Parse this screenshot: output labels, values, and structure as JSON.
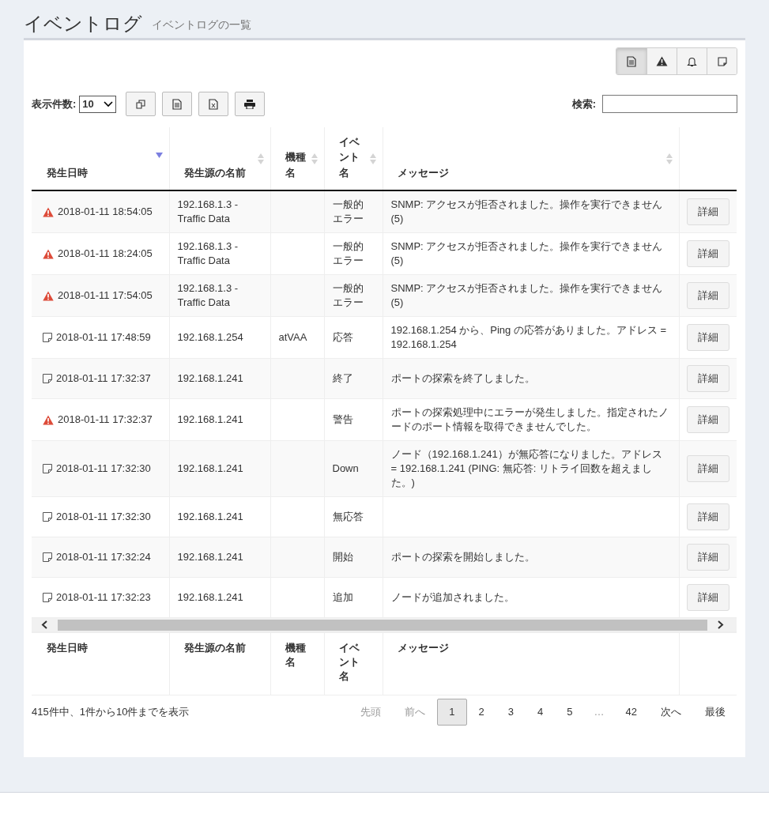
{
  "page": {
    "title": "イベントログ",
    "subtitle": "イベントログの一覧"
  },
  "filter_buttons": [
    {
      "kind": "document",
      "selected": true
    },
    {
      "kind": "warning",
      "selected": false
    },
    {
      "kind": "bell",
      "selected": false
    },
    {
      "kind": "note",
      "selected": false
    }
  ],
  "length": {
    "label": "表示件数:",
    "value": "10"
  },
  "export_buttons": [
    {
      "kind": "copy"
    },
    {
      "kind": "document"
    },
    {
      "kind": "excel"
    },
    {
      "kind": "print"
    }
  ],
  "search": {
    "label": "検索:"
  },
  "table": {
    "columns": [
      {
        "label": "発生日時",
        "sorted": true
      },
      {
        "label": "発生源の名前",
        "sorted": false
      },
      {
        "label": "機種名",
        "sorted": false
      },
      {
        "label": "イベント名",
        "sorted": false
      },
      {
        "label": "メッセージ",
        "sorted": false
      }
    ],
    "rows": [
      {
        "kind": "error",
        "time": "2018-01-11 18:54:05",
        "source": "192.168.1.3 - Traffic Data",
        "model": "",
        "event": "一般的エラー",
        "message": "SNMP: アクセスが拒否されました。操作を実行できません(5)",
        "action": "詳細"
      },
      {
        "kind": "error",
        "time": "2018-01-11 18:24:05",
        "source": "192.168.1.3 - Traffic Data",
        "model": "",
        "event": "一般的エラー",
        "message": "SNMP: アクセスが拒否されました。操作を実行できません(5)",
        "action": "詳細"
      },
      {
        "kind": "error",
        "time": "2018-01-11 17:54:05",
        "source": "192.168.1.3 - Traffic Data",
        "model": "",
        "event": "一般的エラー",
        "message": "SNMP: アクセスが拒否されました。操作を実行できません(5)",
        "action": "詳細"
      },
      {
        "kind": "info",
        "time": "2018-01-11 17:48:59",
        "source": "192.168.1.254",
        "model": "atVAA",
        "event": "応答",
        "message": "192.168.1.254 から、Ping の応答がありました。アドレス = 192.168.1.254",
        "action": "詳細"
      },
      {
        "kind": "info",
        "time": "2018-01-11 17:32:37",
        "source": "192.168.1.241",
        "model": "",
        "event": "終了",
        "message": "ポートの探索を終了しました。",
        "action": "詳細"
      },
      {
        "kind": "error",
        "time": "2018-01-11 17:32:37",
        "source": "192.168.1.241",
        "model": "",
        "event": "警告",
        "message": "ポートの探索処理中にエラーが発生しました。指定されたノードのポート情報を取得できませんでした。",
        "action": "詳細"
      },
      {
        "kind": "info",
        "time": "2018-01-11 17:32:30",
        "source": "192.168.1.241",
        "model": "",
        "event": "Down",
        "message": "ノード（192.168.1.241）が無応答になりました。アドレス = 192.168.1.241 (PING: 無応答: リトライ回数を超えました。)",
        "action": "詳細"
      },
      {
        "kind": "info",
        "time": "2018-01-11 17:32:30",
        "source": "192.168.1.241",
        "model": "",
        "event": "無応答",
        "message": "",
        "action": "詳細"
      },
      {
        "kind": "info",
        "time": "2018-01-11 17:32:24",
        "source": "192.168.1.241",
        "model": "",
        "event": "開始",
        "message": "ポートの探索を開始しました。",
        "action": "詳細"
      },
      {
        "kind": "info",
        "time": "2018-01-11 17:32:23",
        "source": "192.168.1.241",
        "model": "",
        "event": "追加",
        "message": "ノードが追加されました。",
        "action": "詳細"
      }
    ],
    "footer_columns": [
      "発生日時",
      "発生源の名前",
      "機種名",
      "イベント名",
      "メッセージ"
    ]
  },
  "info": "415件中、1件から10件までを表示",
  "pagination": [
    {
      "label": "先頭",
      "kind": "link",
      "disabled": true,
      "selected": false
    },
    {
      "label": "前へ",
      "kind": "link",
      "disabled": true,
      "selected": false
    },
    {
      "label": "1",
      "kind": "link",
      "disabled": false,
      "selected": true
    },
    {
      "label": "2",
      "kind": "link",
      "disabled": false,
      "selected": false
    },
    {
      "label": "3",
      "kind": "link",
      "disabled": false,
      "selected": false
    },
    {
      "label": "4",
      "kind": "link",
      "disabled": false,
      "selected": false
    },
    {
      "label": "5",
      "kind": "link",
      "disabled": false,
      "selected": false
    },
    {
      "label": "…",
      "kind": "ellipsis"
    },
    {
      "label": "42",
      "kind": "link",
      "disabled": false,
      "selected": false
    },
    {
      "label": "次へ",
      "kind": "link",
      "disabled": false,
      "selected": false
    },
    {
      "label": "最後",
      "kind": "link",
      "disabled": false,
      "selected": false
    }
  ]
}
